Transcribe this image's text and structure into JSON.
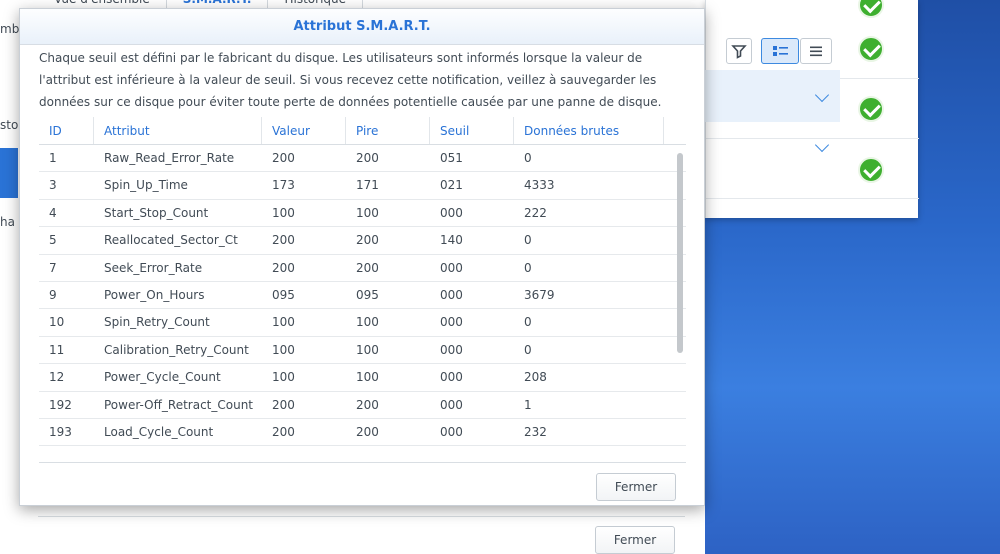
{
  "back_window": {
    "tabs": [
      "Vue d'ensemble",
      "S.M.A.R.T.",
      "Historique"
    ],
    "left_fragments": [
      "mb",
      "sto",
      "ha"
    ],
    "close_label": "Fermer"
  },
  "modal": {
    "title": "Attribut S.M.A.R.T.",
    "description": "Chaque seuil est défini par le fabricant du disque. Les utilisateurs sont informés lorsque la valeur de l'attribut est inférieure à la valeur de seuil. Si vous recevez cette notification, veillez à sauvegarder les données sur ce disque pour éviter toute perte de données potentielle causée par une panne de disque.",
    "columns": [
      "ID",
      "Attribut",
      "Valeur",
      "Pire",
      "Seuil",
      "Données brutes"
    ],
    "rows": [
      [
        "1",
        "Raw_Read_Error_Rate",
        "200",
        "200",
        "051",
        "0"
      ],
      [
        "3",
        "Spin_Up_Time",
        "173",
        "171",
        "021",
        "4333"
      ],
      [
        "4",
        "Start_Stop_Count",
        "100",
        "100",
        "000",
        "222"
      ],
      [
        "5",
        "Reallocated_Sector_Ct",
        "200",
        "200",
        "140",
        "0"
      ],
      [
        "7",
        "Seek_Error_Rate",
        "200",
        "200",
        "000",
        "0"
      ],
      [
        "9",
        "Power_On_Hours",
        "095",
        "095",
        "000",
        "3679"
      ],
      [
        "10",
        "Spin_Retry_Count",
        "100",
        "100",
        "000",
        "0"
      ],
      [
        "11",
        "Calibration_Retry_Count",
        "100",
        "100",
        "000",
        "0"
      ],
      [
        "12",
        "Power_Cycle_Count",
        "100",
        "100",
        "000",
        "208"
      ],
      [
        "192",
        "Power-Off_Retract_Count",
        "200",
        "200",
        "000",
        "1"
      ],
      [
        "193",
        "Load_Cycle_Count",
        "200",
        "200",
        "000",
        "232"
      ]
    ],
    "close_label": "Fermer"
  },
  "right_panel": {
    "icons": [
      "filter-icon",
      "list-detail-icon",
      "list-icon"
    ],
    "status_icons": [
      "check-circle-icon",
      "check-circle-icon",
      "check-circle-icon",
      "check-circle-icon"
    ]
  },
  "colors": {
    "accent": "#2a73d6",
    "ok": "#3eaf2f"
  }
}
